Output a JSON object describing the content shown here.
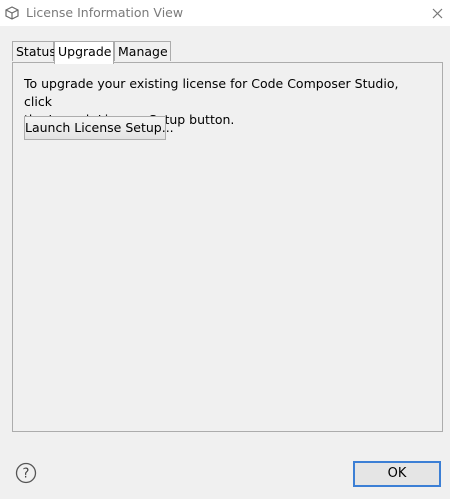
{
  "window": {
    "title": "License Information View",
    "icon": "cube-icon"
  },
  "tabs": [
    {
      "label": "Status",
      "active": false
    },
    {
      "label": "Upgrade",
      "active": true
    },
    {
      "label": "Manage",
      "active": false
    }
  ],
  "upgrade": {
    "message_line1": "To upgrade your existing license for Code Composer Studio, click",
    "message_line2": "the Launch License Setup button.",
    "launch_button_label": "Launch License Setup..."
  },
  "footer": {
    "help_icon": "question-mark-icon",
    "ok_label": "OK"
  },
  "colors": {
    "accent": "#3c7fd5",
    "title_text": "#7a7a7a",
    "border": "#acacac",
    "background": "#f0f0f0"
  }
}
